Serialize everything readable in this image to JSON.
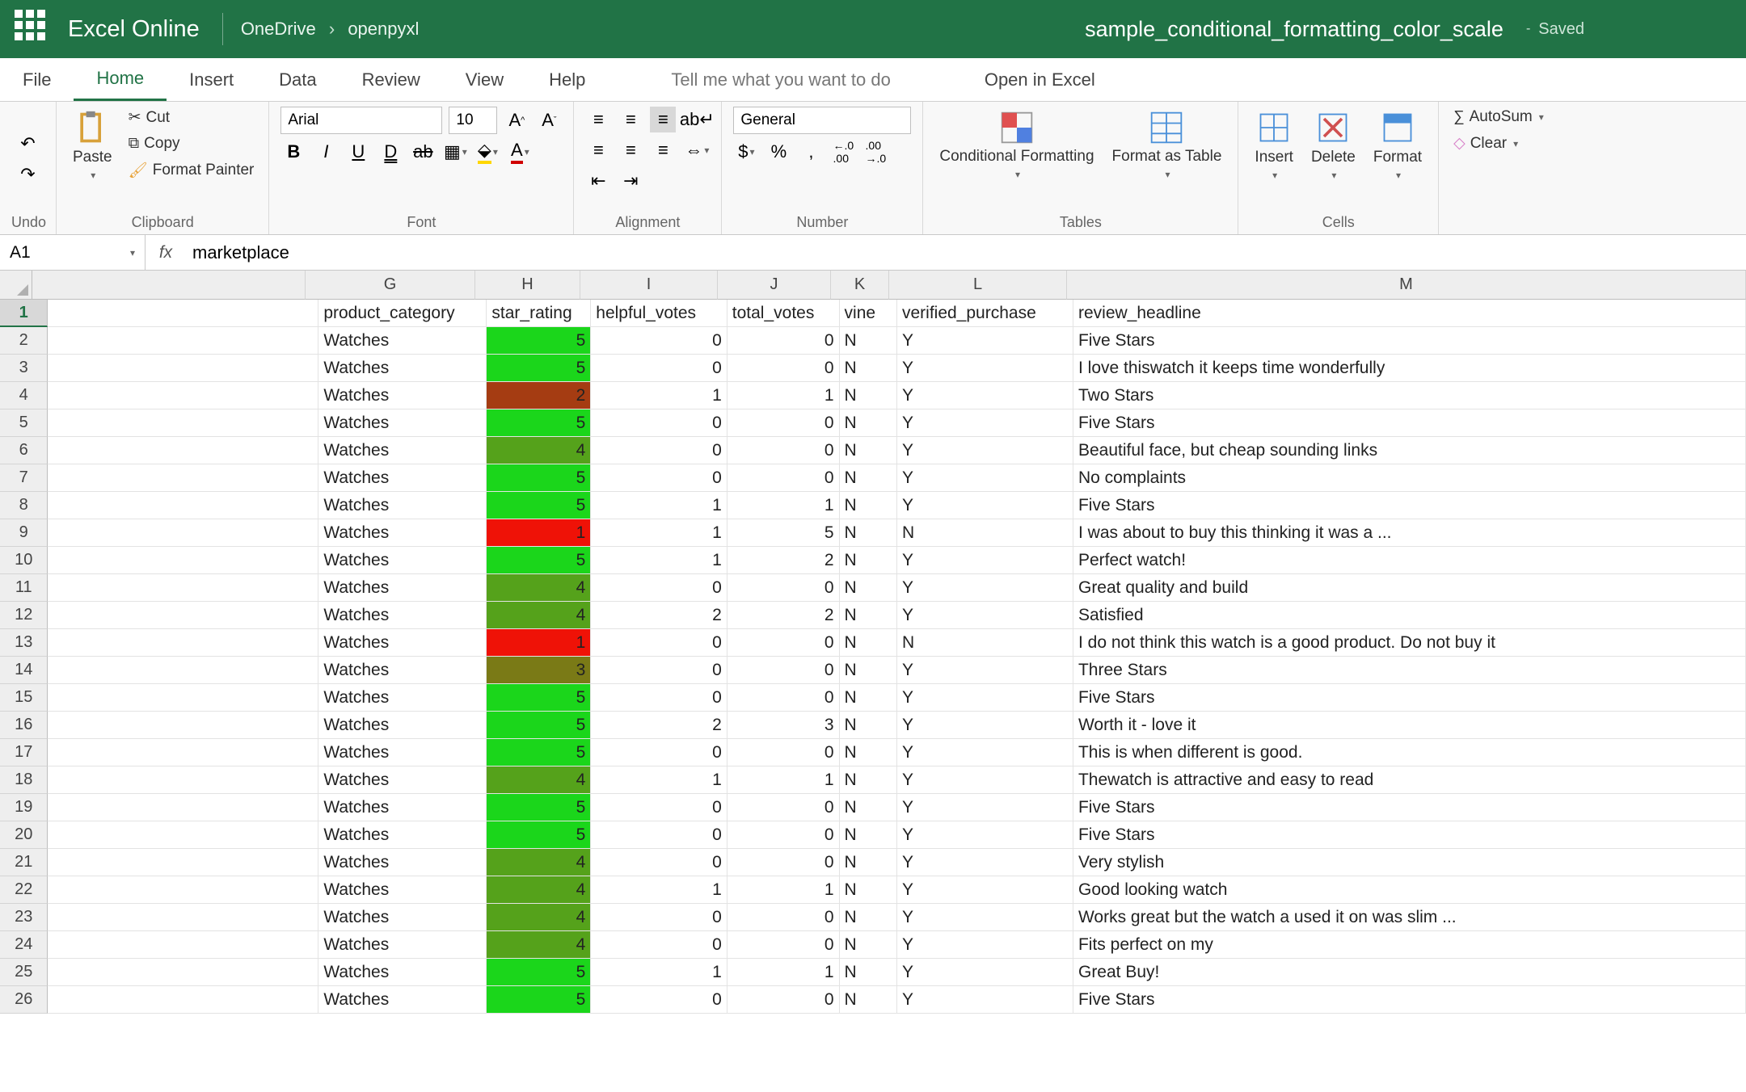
{
  "header": {
    "app": "Excel Online",
    "crumb1": "OneDrive",
    "crumb2": "openpyxl",
    "doc": "sample_conditional_formatting_color_scale",
    "saved": "Saved"
  },
  "tabs": {
    "file": "File",
    "home": "Home",
    "insert": "Insert",
    "data": "Data",
    "review": "Review",
    "view": "View",
    "help": "Help",
    "tell_me": "Tell me what you want to do",
    "open": "Open in Excel"
  },
  "ribbon": {
    "undo": "Undo",
    "paste": "Paste",
    "cut": "Cut",
    "copy": "Copy",
    "fp": "Format Painter",
    "clipboard": "Clipboard",
    "font_name": "Arial",
    "font_size": "10",
    "font": "Font",
    "alignment": "Alignment",
    "num_format": "General",
    "number": "Number",
    "cf": "Conditional Formatting",
    "fat": "Format as Table",
    "tables": "Tables",
    "insert": "Insert",
    "delete": "Delete",
    "format": "Format",
    "cells": "Cells",
    "autosum": "AutoSum",
    "clear": "Clear"
  },
  "fbar": {
    "ref": "A1",
    "value": "marketplace"
  },
  "columns": [
    {
      "key": "blank",
      "label": "",
      "w": "c-blank"
    },
    {
      "key": "G",
      "label": "G",
      "w": "c-G"
    },
    {
      "key": "H",
      "label": "H",
      "w": "c-H"
    },
    {
      "key": "I",
      "label": "I",
      "w": "c-I"
    },
    {
      "key": "J",
      "label": "J",
      "w": "c-J"
    },
    {
      "key": "K",
      "label": "K",
      "w": "c-K"
    },
    {
      "key": "L",
      "label": "L",
      "w": "c-L"
    },
    {
      "key": "M",
      "label": "M",
      "w": "c-M"
    }
  ],
  "field_headers": {
    "G": "product_category",
    "H": "star_rating",
    "I": "helpful_votes",
    "J": "total_votes",
    "K": "vine",
    "L": "verified_purchase",
    "M": "review_headline"
  },
  "rows": [
    {
      "n": 2,
      "G": "Watches",
      "H": 5,
      "I": 0,
      "J": 0,
      "K": "N",
      "L": "Y",
      "M": "Five Stars"
    },
    {
      "n": 3,
      "G": "Watches",
      "H": 5,
      "I": 0,
      "J": 0,
      "K": "N",
      "L": "Y",
      "M": "I love thiswatch it keeps time wonderfully"
    },
    {
      "n": 4,
      "G": "Watches",
      "H": 2,
      "I": 1,
      "J": 1,
      "K": "N",
      "L": "Y",
      "M": "Two Stars"
    },
    {
      "n": 5,
      "G": "Watches",
      "H": 5,
      "I": 0,
      "J": 0,
      "K": "N",
      "L": "Y",
      "M": "Five Stars"
    },
    {
      "n": 6,
      "G": "Watches",
      "H": 4,
      "I": 0,
      "J": 0,
      "K": "N",
      "L": "Y",
      "M": "Beautiful face, but cheap sounding links"
    },
    {
      "n": 7,
      "G": "Watches",
      "H": 5,
      "I": 0,
      "J": 0,
      "K": "N",
      "L": "Y",
      "M": "No complaints"
    },
    {
      "n": 8,
      "G": "Watches",
      "H": 5,
      "I": 1,
      "J": 1,
      "K": "N",
      "L": "Y",
      "M": "Five Stars"
    },
    {
      "n": 9,
      "G": "Watches",
      "H": 1,
      "I": 1,
      "J": 5,
      "K": "N",
      "L": "N",
      "M": "I was about to buy this thinking it was a ..."
    },
    {
      "n": 10,
      "G": "Watches",
      "H": 5,
      "I": 1,
      "J": 2,
      "K": "N",
      "L": "Y",
      "M": "Perfect watch!"
    },
    {
      "n": 11,
      "G": "Watches",
      "H": 4,
      "I": 0,
      "J": 0,
      "K": "N",
      "L": "Y",
      "M": "Great quality and build"
    },
    {
      "n": 12,
      "G": "Watches",
      "H": 4,
      "I": 2,
      "J": 2,
      "K": "N",
      "L": "Y",
      "M": "Satisfied"
    },
    {
      "n": 13,
      "G": "Watches",
      "H": 1,
      "I": 0,
      "J": 0,
      "K": "N",
      "L": "N",
      "M": "I do not think this watch is a good product. Do not buy it"
    },
    {
      "n": 14,
      "G": "Watches",
      "H": 3,
      "I": 0,
      "J": 0,
      "K": "N",
      "L": "Y",
      "M": "Three Stars"
    },
    {
      "n": 15,
      "G": "Watches",
      "H": 5,
      "I": 0,
      "J": 0,
      "K": "N",
      "L": "Y",
      "M": "Five Stars"
    },
    {
      "n": 16,
      "G": "Watches",
      "H": 5,
      "I": 2,
      "J": 3,
      "K": "N",
      "L": "Y",
      "M": "Worth it - love it"
    },
    {
      "n": 17,
      "G": "Watches",
      "H": 5,
      "I": 0,
      "J": 0,
      "K": "N",
      "L": "Y",
      "M": "This is when different is good."
    },
    {
      "n": 18,
      "G": "Watches",
      "H": 4,
      "I": 1,
      "J": 1,
      "K": "N",
      "L": "Y",
      "M": "Thewatch is attractive and easy to read"
    },
    {
      "n": 19,
      "G": "Watches",
      "H": 5,
      "I": 0,
      "J": 0,
      "K": "N",
      "L": "Y",
      "M": "Five Stars"
    },
    {
      "n": 20,
      "G": "Watches",
      "H": 5,
      "I": 0,
      "J": 0,
      "K": "N",
      "L": "Y",
      "M": "Five Stars"
    },
    {
      "n": 21,
      "G": "Watches",
      "H": 4,
      "I": 0,
      "J": 0,
      "K": "N",
      "L": "Y",
      "M": "Very stylish"
    },
    {
      "n": 22,
      "G": "Watches",
      "H": 4,
      "I": 1,
      "J": 1,
      "K": "N",
      "L": "Y",
      "M": "Good looking watch"
    },
    {
      "n": 23,
      "G": "Watches",
      "H": 4,
      "I": 0,
      "J": 0,
      "K": "N",
      "L": "Y",
      "M": "Works great but the watch a used it on was slim ..."
    },
    {
      "n": 24,
      "G": "Watches",
      "H": 4,
      "I": 0,
      "J": 0,
      "K": "N",
      "L": "Y",
      "M": "Fits perfect on my"
    },
    {
      "n": 25,
      "G": "Watches",
      "H": 5,
      "I": 1,
      "J": 1,
      "K": "N",
      "L": "Y",
      "M": "Great Buy!"
    },
    {
      "n": 26,
      "G": "Watches",
      "H": 5,
      "I": 0,
      "J": 0,
      "K": "N",
      "L": "Y",
      "M": "Five Stars"
    }
  ]
}
